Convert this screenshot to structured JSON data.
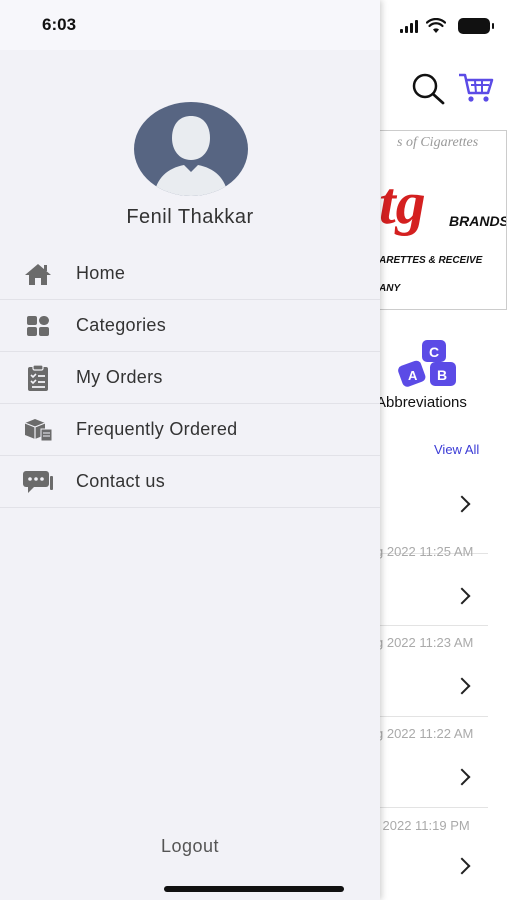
{
  "status": {
    "time": "6:03"
  },
  "profile": {
    "name": "Fenil  Thakkar"
  },
  "menu": [
    {
      "label": "Home",
      "icon": "home-icon"
    },
    {
      "label": "Categories",
      "icon": "grid-icon"
    },
    {
      "label": "My Orders",
      "icon": "clipboard-icon"
    },
    {
      "label": "Frequently Ordered",
      "icon": "packages-icon"
    },
    {
      "label": "Contact us",
      "icon": "chat-icon"
    }
  ],
  "logout_label": "Logout",
  "background": {
    "banner": {
      "line1": "s of Cigarettes",
      "logo": "tg",
      "brands": "BRANDS™",
      "line3": "ARETTES & RECEIVE",
      "line4": "ANY"
    },
    "abbreviations_label": "Abbreviations",
    "view_all_label": "View All",
    "order_dates": [
      "g 2022 11:25 AM",
      "g 2022 11:23 AM",
      "g 2022 11:22 AM",
      "l 2022 11:19 PM"
    ]
  },
  "colors": {
    "accent": "#5b4be6",
    "drawer_bg": "#f2f2f7",
    "avatar_bg": "#576582",
    "brand_red": "#d42020"
  }
}
